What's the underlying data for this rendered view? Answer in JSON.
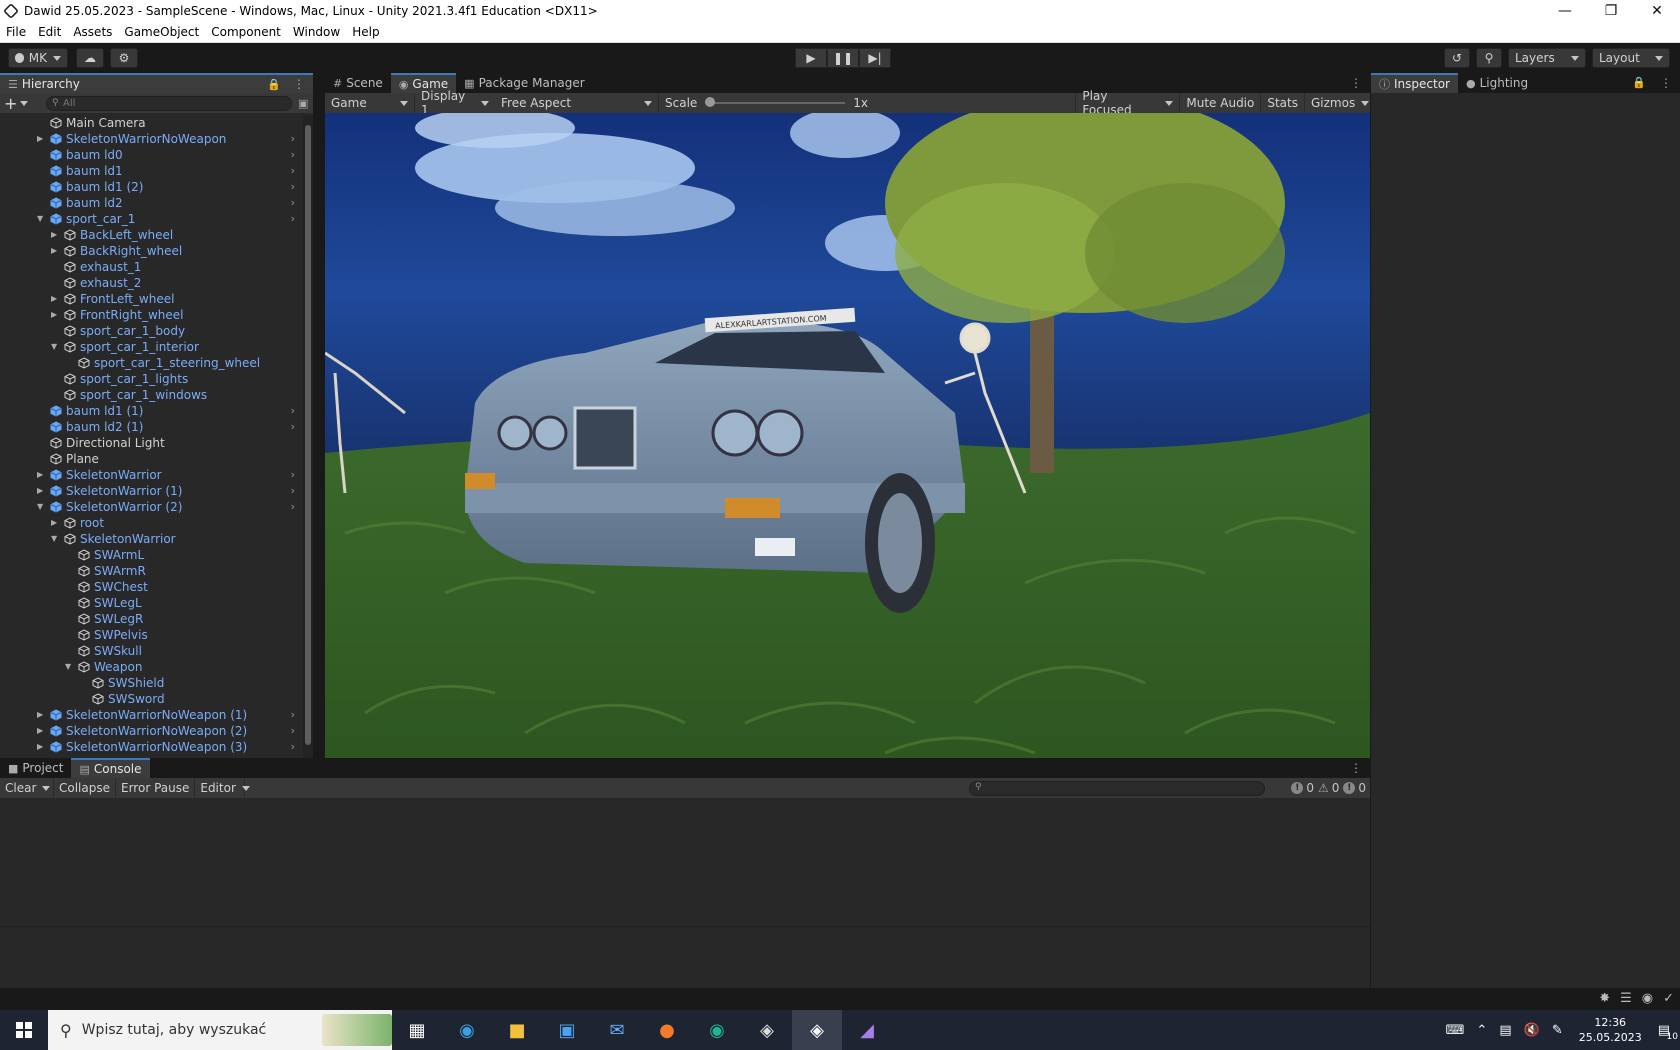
{
  "window": {
    "title": "Dawid 25.05.2023 - SampleScene - Windows, Mac, Linux - Unity 2021.3.4f1 Education <DX11>"
  },
  "menu": [
    "File",
    "Edit",
    "Assets",
    "GameObject",
    "Component",
    "Window",
    "Help"
  ],
  "toolbar": {
    "account_label": "MK",
    "layers_label": "Layers",
    "layout_label": "Layout"
  },
  "hierarchy": {
    "tab_label": "Hierarchy",
    "search_placeholder": "All",
    "items": [
      {
        "label": "Main Camera",
        "depth": 1,
        "arrow": "",
        "prefab": false,
        "goto": false
      },
      {
        "label": "SkeletonWarriorNoWeapon",
        "depth": 1,
        "arrow": "collapsed",
        "prefab": true,
        "goto": true
      },
      {
        "label": "baum ld0",
        "depth": 1,
        "arrow": "",
        "prefab": true,
        "goto": true
      },
      {
        "label": "baum ld1",
        "depth": 1,
        "arrow": "",
        "prefab": true,
        "goto": true
      },
      {
        "label": "baum ld1 (2)",
        "depth": 1,
        "arrow": "",
        "prefab": true,
        "goto": true
      },
      {
        "label": "baum ld2",
        "depth": 1,
        "arrow": "",
        "prefab": true,
        "goto": true
      },
      {
        "label": "sport_car_1",
        "depth": 1,
        "arrow": "expanded",
        "prefab": true,
        "goto": true
      },
      {
        "label": "BackLeft_wheel",
        "depth": 2,
        "arrow": "collapsed",
        "prefab": true,
        "goto": false
      },
      {
        "label": "BackRight_wheel",
        "depth": 2,
        "arrow": "collapsed",
        "prefab": true,
        "goto": false
      },
      {
        "label": "exhaust_1",
        "depth": 2,
        "arrow": "",
        "prefab": true,
        "goto": false
      },
      {
        "label": "exhaust_2",
        "depth": 2,
        "arrow": "",
        "prefab": true,
        "goto": false
      },
      {
        "label": "FrontLeft_wheel",
        "depth": 2,
        "arrow": "collapsed",
        "prefab": true,
        "goto": false
      },
      {
        "label": "FrontRight_wheel",
        "depth": 2,
        "arrow": "collapsed",
        "prefab": true,
        "goto": false
      },
      {
        "label": "sport_car_1_body",
        "depth": 2,
        "arrow": "",
        "prefab": true,
        "goto": false
      },
      {
        "label": "sport_car_1_interior",
        "depth": 2,
        "arrow": "expanded",
        "prefab": true,
        "goto": false
      },
      {
        "label": "sport_car_1_steering_wheel",
        "depth": 3,
        "arrow": "",
        "prefab": true,
        "goto": false
      },
      {
        "label": "sport_car_1_lights",
        "depth": 2,
        "arrow": "",
        "prefab": true,
        "goto": false
      },
      {
        "label": "sport_car_1_windows",
        "depth": 2,
        "arrow": "",
        "prefab": true,
        "goto": false
      },
      {
        "label": "baum ld1 (1)",
        "depth": 1,
        "arrow": "",
        "prefab": true,
        "goto": true
      },
      {
        "label": "baum ld2 (1)",
        "depth": 1,
        "arrow": "",
        "prefab": true,
        "goto": true
      },
      {
        "label": "Directional Light",
        "depth": 1,
        "arrow": "",
        "prefab": false,
        "goto": false
      },
      {
        "label": "Plane",
        "depth": 1,
        "arrow": "",
        "prefab": false,
        "goto": false
      },
      {
        "label": "SkeletonWarrior",
        "depth": 1,
        "arrow": "collapsed",
        "prefab": true,
        "goto": true
      },
      {
        "label": "SkeletonWarrior (1)",
        "depth": 1,
        "arrow": "collapsed",
        "prefab": true,
        "goto": true
      },
      {
        "label": "SkeletonWarrior (2)",
        "depth": 1,
        "arrow": "expanded",
        "prefab": true,
        "goto": true
      },
      {
        "label": "root",
        "depth": 2,
        "arrow": "collapsed",
        "prefab": true,
        "goto": false
      },
      {
        "label": "SkeletonWarrior",
        "depth": 2,
        "arrow": "expanded",
        "prefab": true,
        "goto": false
      },
      {
        "label": "SWArmL",
        "depth": 3,
        "arrow": "",
        "prefab": true,
        "goto": false
      },
      {
        "label": "SWArmR",
        "depth": 3,
        "arrow": "",
        "prefab": true,
        "goto": false
      },
      {
        "label": "SWChest",
        "depth": 3,
        "arrow": "",
        "prefab": true,
        "goto": false
      },
      {
        "label": "SWLegL",
        "depth": 3,
        "arrow": "",
        "prefab": true,
        "goto": false
      },
      {
        "label": "SWLegR",
        "depth": 3,
        "arrow": "",
        "prefab": true,
        "goto": false
      },
      {
        "label": "SWPelvis",
        "depth": 3,
        "arrow": "",
        "prefab": true,
        "goto": false
      },
      {
        "label": "SWSkull",
        "depth": 3,
        "arrow": "",
        "prefab": true,
        "goto": false
      },
      {
        "label": "Weapon",
        "depth": 3,
        "arrow": "expanded",
        "prefab": true,
        "goto": false
      },
      {
        "label": "SWShield",
        "depth": 4,
        "arrow": "",
        "prefab": true,
        "goto": false
      },
      {
        "label": "SWSword",
        "depth": 4,
        "arrow": "",
        "prefab": true,
        "goto": false
      },
      {
        "label": "SkeletonWarriorNoWeapon (1)",
        "depth": 1,
        "arrow": "collapsed",
        "prefab": true,
        "goto": true
      },
      {
        "label": "SkeletonWarriorNoWeapon (2)",
        "depth": 1,
        "arrow": "collapsed",
        "prefab": true,
        "goto": true
      },
      {
        "label": "SkeletonWarriorNoWeapon (3)",
        "depth": 1,
        "arrow": "collapsed",
        "prefab": true,
        "goto": true
      }
    ]
  },
  "center_tabs": {
    "scene": "Scene",
    "game": "Game",
    "package_manager": "Package Manager"
  },
  "game_toolbar": {
    "mode": "Game",
    "display": "Display 1",
    "aspect": "Free Aspect",
    "scale_label": "Scale",
    "scale_value": "1x",
    "play_focused": "Play Focused",
    "mute_audio": "Mute Audio",
    "stats": "Stats",
    "gizmos": "Gizmos"
  },
  "game_scene": {
    "car_banner_text": "ALEXKARLARTSTATION.COM"
  },
  "right_tabs": {
    "inspector": "Inspector",
    "lighting": "Lighting"
  },
  "bottom_tabs": {
    "project": "Project",
    "console": "Console"
  },
  "console_toolbar": {
    "clear": "Clear",
    "collapse": "Collapse",
    "error_pause": "Error Pause",
    "editor": "Editor",
    "log_count": "0",
    "warning_count": "0",
    "error_count": "0"
  },
  "taskbar": {
    "search_placeholder": "Wpisz tutaj, aby wyszukać",
    "time": "12:36",
    "date": "25.05.2023",
    "notification_count": "10"
  },
  "colors": {
    "accent": "#3a79bb",
    "prefab_text": "#7cacf8",
    "sky": "#1d3a7a",
    "grass": "#3f6a2a"
  }
}
